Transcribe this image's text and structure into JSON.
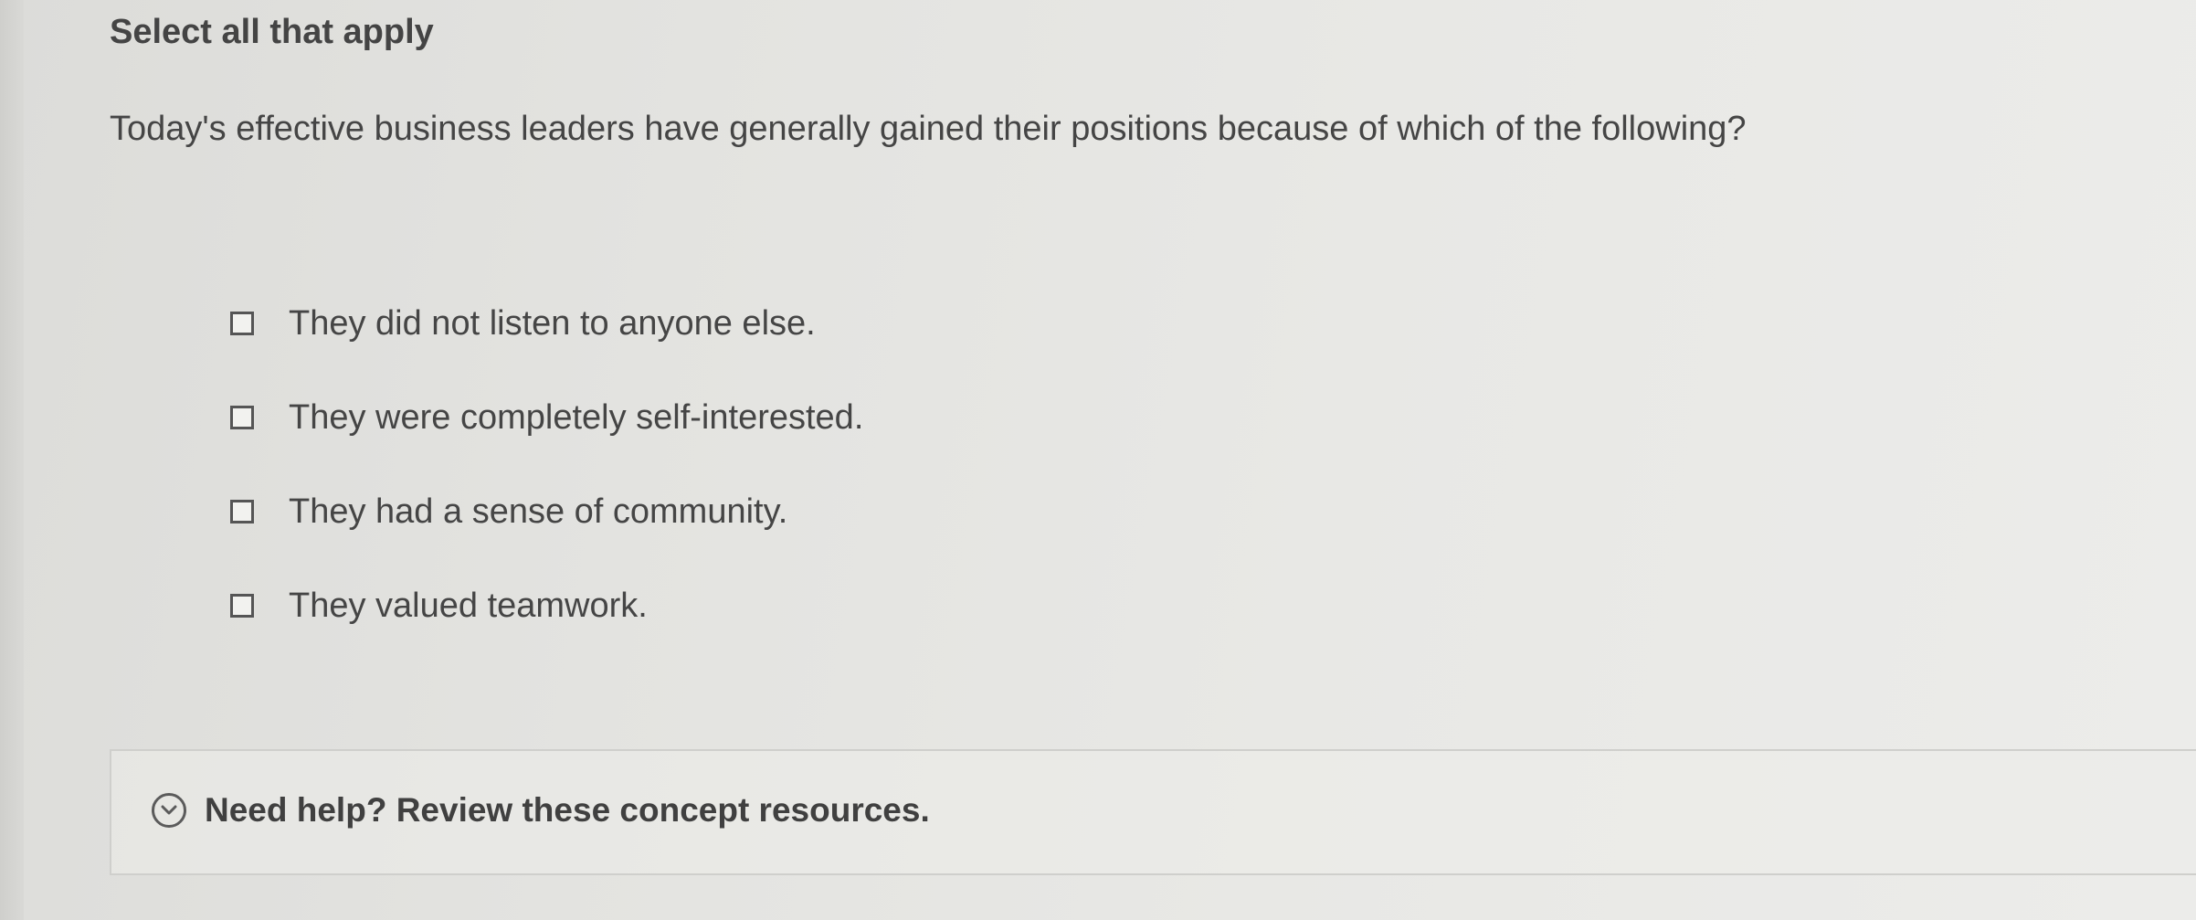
{
  "instruction": "Select all that apply",
  "question": "Today's effective business leaders have generally gained their positions because of which of the following?",
  "options": [
    {
      "label": "They did not listen to anyone else.",
      "checked": false
    },
    {
      "label": "They were completely self-interested.",
      "checked": false
    },
    {
      "label": "They had a sense of community.",
      "checked": false
    },
    {
      "label": "They valued teamwork.",
      "checked": false
    }
  ],
  "help": {
    "label": "Need help? Review these concept resources.",
    "icon": "chevron-down-circle-icon"
  }
}
